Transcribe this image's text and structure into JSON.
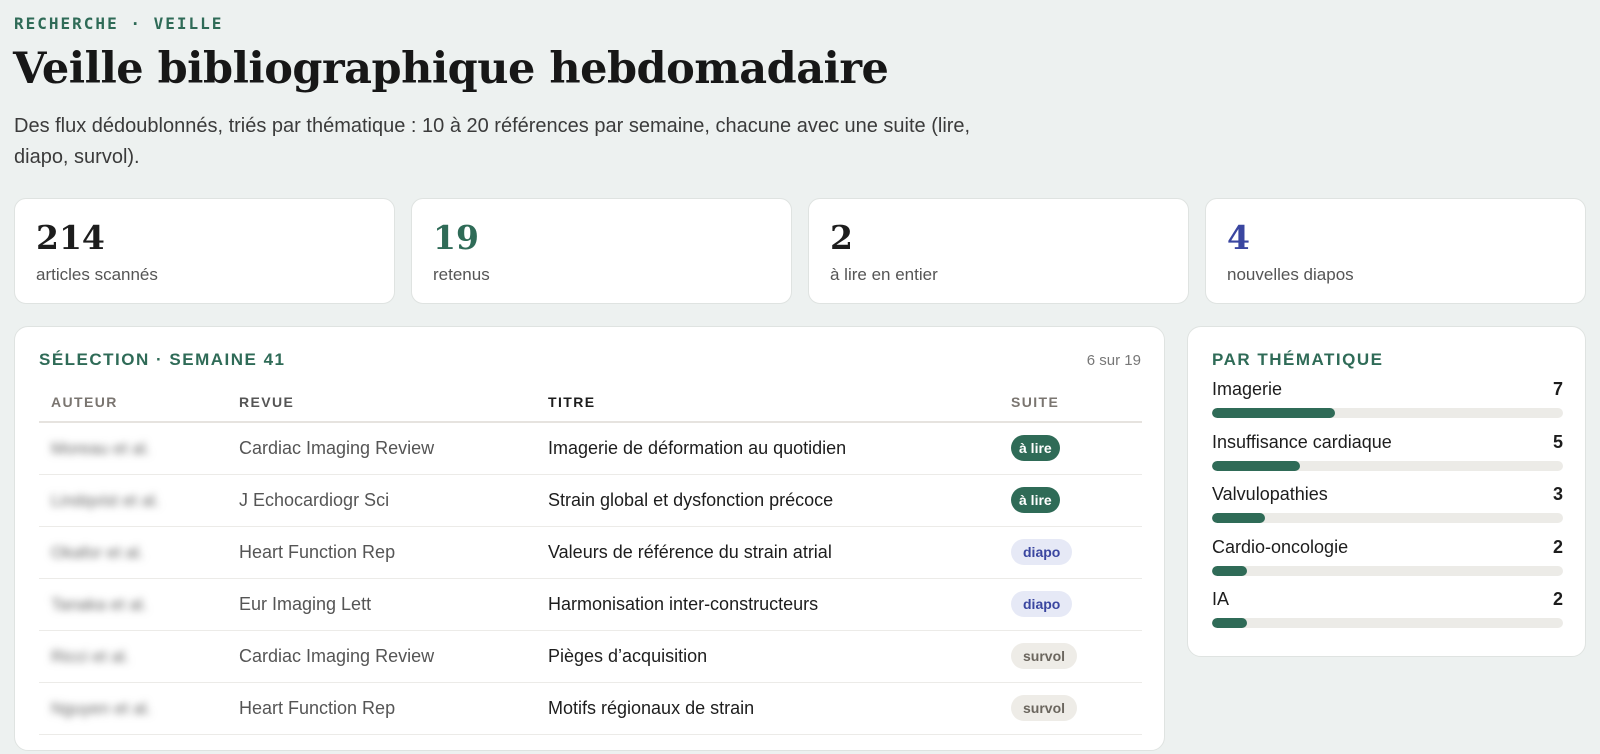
{
  "header": {
    "eyebrow": "RECHERCHE · VEILLE",
    "title": "Veille bibliographique hebdomadaire",
    "subtitle": "Des flux dédoublonnés, triés par thématique : 10 à 20 références par semaine, chacune avec une suite (lire, diapo, survol)."
  },
  "stats": [
    {
      "value": "214",
      "label": "articles scannés",
      "color": "#1d1d1d"
    },
    {
      "value": "19",
      "label": "retenus",
      "color": "#2f6b57"
    },
    {
      "value": "2",
      "label": "à lire en entier",
      "color": "#1d1d1d"
    },
    {
      "value": "4",
      "label": "nouvelles diapos",
      "color": "#3a46a0"
    }
  ],
  "selection": {
    "heading": "SÉLECTION · SEMAINE 41",
    "count": "6 sur 19",
    "columns": [
      "AUTEUR",
      "REVUE",
      "TITRE",
      "SUITE"
    ],
    "rows": [
      {
        "author": "Moreau et al.",
        "revue": "Cardiac Imaging Review",
        "titre": "Imagerie de déformation au quotidien",
        "suite": "à lire",
        "kind": "lire"
      },
      {
        "author": "Lindqvist et al.",
        "revue": "J Echocardiogr Sci",
        "titre": "Strain global et dysfonction précoce",
        "suite": "à lire",
        "kind": "lire"
      },
      {
        "author": "Okafor et al.",
        "revue": "Heart Function Rep",
        "titre": "Valeurs de référence du strain atrial",
        "suite": "diapo",
        "kind": "diapo"
      },
      {
        "author": "Tanaka et al.",
        "revue": "Eur Imaging Lett",
        "titre": "Harmonisation inter-constructeurs",
        "suite": "diapo",
        "kind": "diapo"
      },
      {
        "author": "Ricci et al.",
        "revue": "Cardiac Imaging Review",
        "titre": "Pièges d’acquisition",
        "suite": "survol",
        "kind": "survol"
      },
      {
        "author": "Nguyen et al.",
        "revue": "Heart Function Rep",
        "titre": "Motifs régionaux de strain",
        "suite": "survol",
        "kind": "survol"
      }
    ]
  },
  "themes": {
    "heading": "PAR THÉMATIQUE",
    "items": [
      {
        "label": "Imagerie",
        "count": 7,
        "fraction": 0.35
      },
      {
        "label": "Insuffisance cardiaque",
        "count": 5,
        "fraction": 0.25
      },
      {
        "label": "Valvulopathies",
        "count": 3,
        "fraction": 0.15
      },
      {
        "label": "Cardio-oncologie",
        "count": 2,
        "fraction": 0.1
      },
      {
        "label": "IA",
        "count": 2,
        "fraction": 0.1
      }
    ]
  }
}
